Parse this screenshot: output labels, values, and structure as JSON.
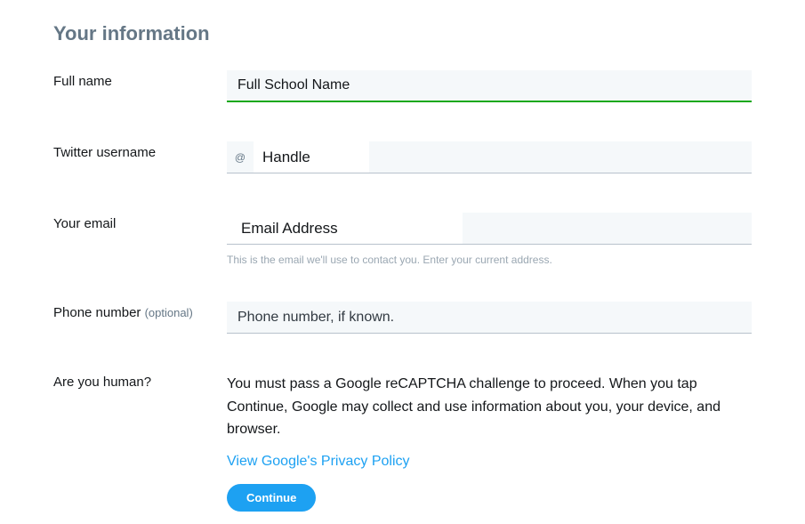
{
  "heading": "Your information",
  "fields": {
    "fullName": {
      "label": "Full name",
      "value": "Full School Name"
    },
    "username": {
      "label": "Twitter username",
      "prefix": "@",
      "value": "Handle"
    },
    "email": {
      "label": "Your email",
      "value": "Email Address",
      "help": "This is the email we'll use to contact you. Enter your current address."
    },
    "phone": {
      "label": "Phone number ",
      "optional": "(optional)",
      "placeholder": "Phone number, if known."
    }
  },
  "captcha": {
    "label": "Are you human?",
    "text": "You must pass a Google reCAPTCHA challenge to proceed. When you tap Continue, Google may collect and use information about you, your device, and browser.",
    "privacyLink": "View Google's Privacy Policy",
    "button": "Continue"
  }
}
